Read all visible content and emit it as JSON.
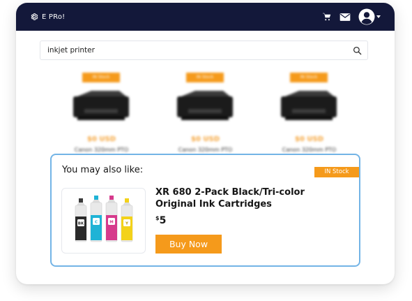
{
  "header": {
    "brand": "E PRo!",
    "icons": [
      "gear-icon",
      "cart-icon",
      "mail-icon",
      "user-avatar-icon",
      "caret-down-icon"
    ],
    "background": "#13183a"
  },
  "search": {
    "value": "inkjet printer",
    "icon": "search-icon"
  },
  "products": [
    {
      "badge": "IN Stock",
      "price": "$0 USD",
      "name": "Canon 320mm PTO"
    },
    {
      "badge": "IN Stock",
      "price": "$0 USD",
      "name": "Canon 320mm PTO"
    },
    {
      "badge": "IN Stock",
      "price": "$0 USD",
      "name": "Canon 320mm PTO"
    }
  ],
  "recommendation": {
    "heading": "You may also like:",
    "stock_badge": "IN Stock",
    "title": "XR 680 2-Pack Black/Tri-color Original Ink Cartridges",
    "currency": "$",
    "price": "5",
    "buy_label": "Buy Now",
    "bottle_labels": [
      "BK",
      "C",
      "M",
      "Y"
    ],
    "border_color": "#73b4e6"
  },
  "colors": {
    "accent": "#f59a1b",
    "bottle_black": "#2a2a2a",
    "bottle_cyan": "#1fb3d6",
    "bottle_magenta": "#d63a8c",
    "bottle_yellow": "#f3d21a"
  }
}
